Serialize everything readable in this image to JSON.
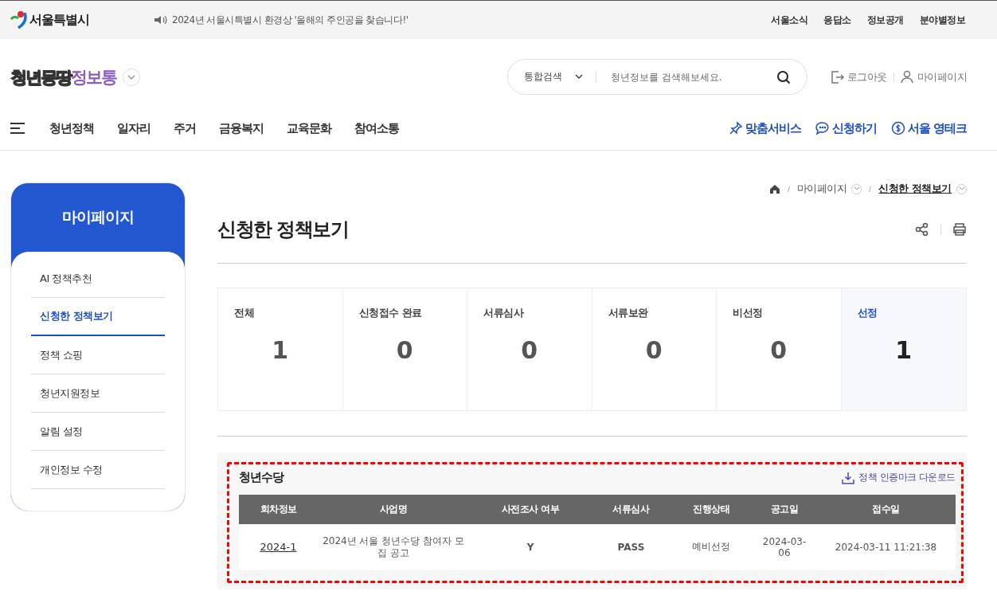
{
  "top_bar": {
    "brand": "서울특별시",
    "notice": "2024년 서울시특별시 환경상 '올해의 주인공을 찾습니다!'",
    "links": [
      "서울소식",
      "응답소",
      "정보공개",
      "분야별정보"
    ]
  },
  "header": {
    "logo_parts": [
      "청년",
      "몽땅",
      "정보통"
    ],
    "search": {
      "scope": "통합검색",
      "placeholder": "청년정보를 검색해보세요."
    },
    "user_links": [
      {
        "kind": "logout",
        "label": "로그아웃"
      },
      {
        "kind": "user",
        "label": "마이페이지"
      }
    ]
  },
  "nav": {
    "items": [
      "청년정책",
      "일자리",
      "주거",
      "금융복지",
      "교육문화",
      "참여소통"
    ],
    "quick_links": [
      {
        "kind": "pin",
        "label": "맞춤서비스"
      },
      {
        "kind": "chat",
        "label": "신청하기"
      },
      {
        "kind": "coin",
        "label": "서울 영테크"
      }
    ]
  },
  "sidebar": {
    "title": "마이페이지",
    "items": [
      {
        "label": "AI 정책추천",
        "selected": false
      },
      {
        "label": "신청한 정책보기",
        "selected": true
      },
      {
        "label": "정책 쇼핑",
        "selected": false
      },
      {
        "label": "청년지원정보",
        "selected": false
      },
      {
        "label": "알림 설정",
        "selected": false
      },
      {
        "label": "개인정보 수정",
        "selected": false
      }
    ]
  },
  "breadcrumb": [
    "마이페이지",
    "신청한 정책보기"
  ],
  "page_title": "신청한 정책보기",
  "stats": [
    {
      "label": "전체",
      "count": "1",
      "selected": false
    },
    {
      "label": "신청접수 완료",
      "count": "0",
      "selected": false
    },
    {
      "label": "서류심사",
      "count": "0",
      "selected": false
    },
    {
      "label": "서류보완",
      "count": "0",
      "selected": false
    },
    {
      "label": "비선정",
      "count": "0",
      "selected": false
    },
    {
      "label": "선정",
      "count": "1",
      "selected": true
    }
  ],
  "section": {
    "title": "청년수당",
    "highlighted": true,
    "download": "정책 인증마크 다운로드",
    "table": {
      "columns": [
        "회차정보",
        "사업명",
        "사전조사 여부",
        "서류심사",
        "진행상태",
        "공고일",
        "접수일"
      ],
      "rows": [
        [
          "2024-1",
          "2024년 서울 청년수당 참여자 모집 공고",
          "Y",
          "PASS",
          "예비선정",
          "2024-03-06",
          "2024-03-11 11:21:38"
        ]
      ]
    }
  }
}
